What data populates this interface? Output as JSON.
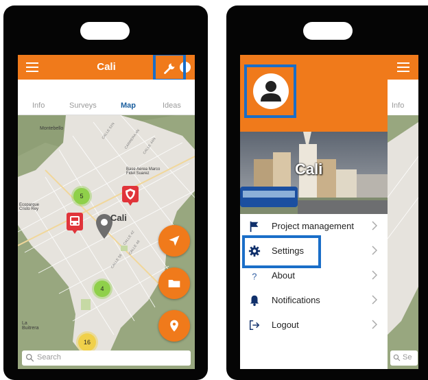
{
  "left_phone": {
    "appbar": {
      "title": "Cali"
    },
    "tabs": [
      "Info",
      "Surveys",
      "Map",
      "Ideas"
    ],
    "active_tab": "Map",
    "map": {
      "city_label": "Cali",
      "clusters": [
        "5",
        "4",
        "16"
      ],
      "places": [
        "Montebello",
        "Ecoparque Cristo Rey",
        "La Buitrera",
        "Base Aerea Marco Fidel Suarez"
      ],
      "search_placeholder": "Search"
    }
  },
  "right_phone": {
    "drawer": {
      "city": "Cali",
      "menu": [
        {
          "label": "Project management",
          "icon": "flag-icon"
        },
        {
          "label": "Settings",
          "icon": "gear-icon"
        },
        {
          "label": "About",
          "icon": "question-icon"
        },
        {
          "label": "Notifications",
          "icon": "bell-icon"
        },
        {
          "label": "Logout",
          "icon": "logout-icon"
        }
      ]
    },
    "background_app": {
      "tab": "Info",
      "search_placeholder": "Se"
    }
  },
  "colors": {
    "brand_orange": "#f07a1b",
    "highlight_blue": "#1a6ec8",
    "active_tab": "#1a5e9e"
  }
}
